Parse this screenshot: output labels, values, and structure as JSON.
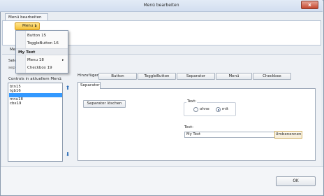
{
  "window": {
    "title": "Menü bearbeiten",
    "close_symbol": "x"
  },
  "ribbon": {
    "tab_label": "Menü bearbeiten",
    "menu_button_label": "Menu 1",
    "menu_button_arrow": "▾",
    "partial_label": "Me"
  },
  "popup": {
    "items": [
      {
        "label": "Button 15"
      },
      {
        "label": "ToggleButton 16"
      }
    ],
    "header": "My Text",
    "submenu": {
      "label": "Menu 18",
      "arrow": "▸"
    },
    "last_item": {
      "label": "Checkbox 19"
    }
  },
  "left_panel": {
    "partial_label_1": "Sele",
    "partial_label_2": "sep",
    "controls_label": "Controls in aktuellem Menü:",
    "list": [
      "btn15",
      "tgb16",
      "",
      "mnu18",
      "cbx19"
    ],
    "selected_index": 2,
    "up_arrow": "⬆",
    "down_arrow": "⬇"
  },
  "add_section": {
    "label": "Hinzufügen:",
    "buttons": [
      "Button",
      "ToggleButton",
      "Separator",
      "Menü",
      "Checkbox"
    ]
  },
  "tab": {
    "label": "Separator"
  },
  "separator_panel": {
    "delete_button": "Separator löschen",
    "text_group_label": "Text:",
    "radio_options": [
      "ohne",
      "mit"
    ],
    "radio_selected": "mit",
    "text_field_label": "Text:",
    "text_value": "My Text",
    "rename_button": "Umbenennen"
  },
  "footer": {
    "ok_label": "OK"
  }
}
